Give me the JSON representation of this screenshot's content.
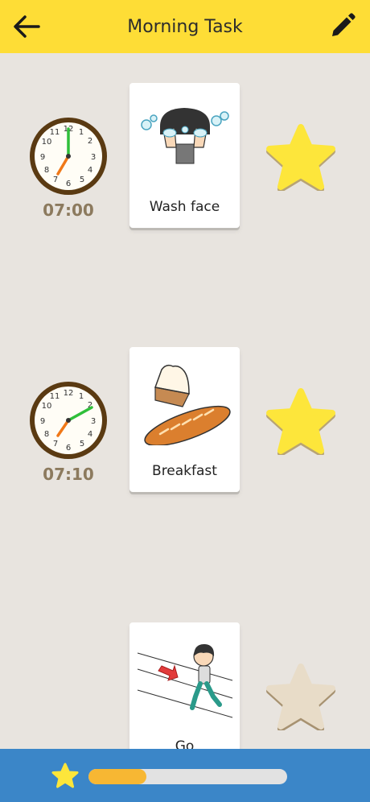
{
  "header": {
    "title": "Morning Task",
    "back_icon": "arrow-left-icon",
    "edit_icon": "pencil-icon",
    "background_color": "#fedd36"
  },
  "tasks": [
    {
      "time": "07:00",
      "label": "Wash face",
      "hour": 7,
      "minute": 0,
      "starred": true
    },
    {
      "time": "07:10",
      "label": "Breakfast",
      "hour": 7,
      "minute": 10,
      "starred": true
    },
    {
      "label": "Go",
      "starred": false
    }
  ],
  "footer": {
    "icon": "star-icon",
    "progress_fraction": 0.29,
    "background_color": "#3b86c8"
  },
  "colors": {
    "star_active": "#fde63b",
    "star_inactive": "#e8dcc8",
    "time_text": "#8c7a5e",
    "progress_fill": "#f7b733"
  }
}
